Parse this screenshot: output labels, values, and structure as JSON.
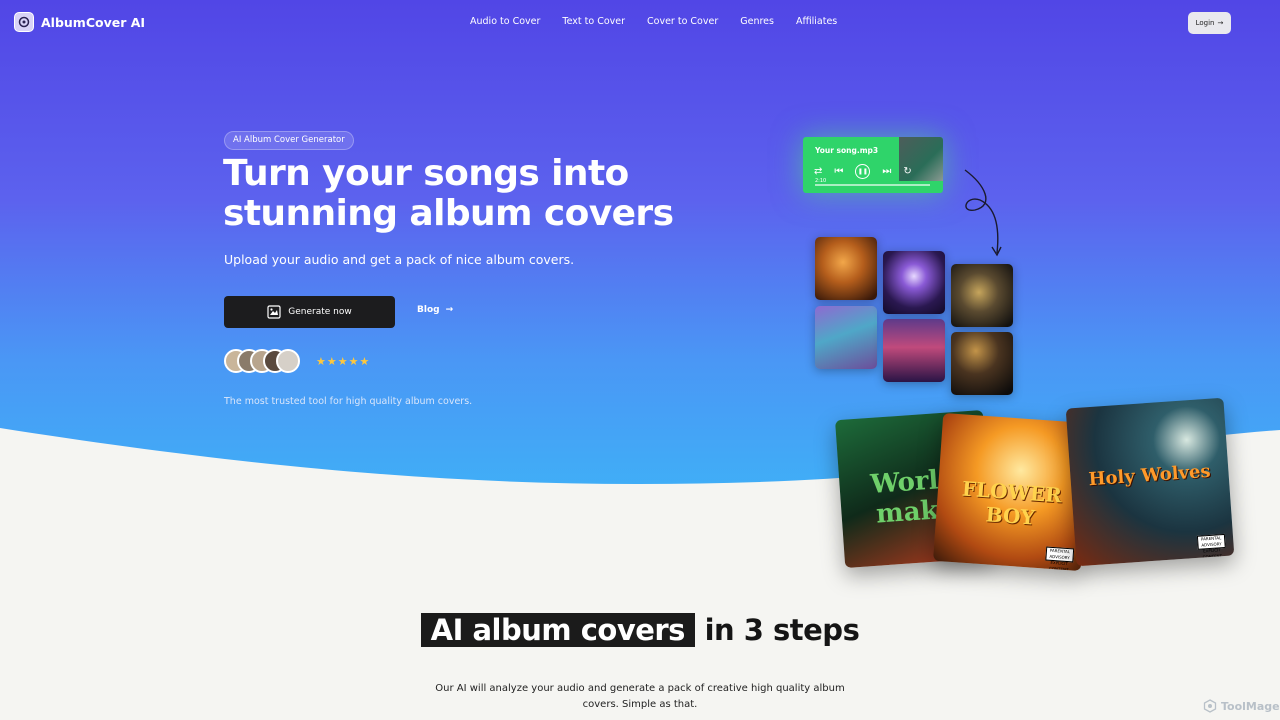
{
  "brand": {
    "name": "AlbumCover AI"
  },
  "nav": {
    "items": [
      "Audio to Cover",
      "Text to Cover",
      "Cover to Cover",
      "Genres",
      "Affiliates"
    ],
    "login_label": "Login"
  },
  "hero": {
    "badge": "AI Album Cover Generator",
    "title_line1": "Turn your songs into",
    "title_line2": "stunning album covers",
    "subtitle": "Upload your audio and get a pack of nice album covers.",
    "generate_label": "Generate now",
    "blog_label": "Blog",
    "stars": "★★★★★",
    "trusted": "The most trusted tool for high quality album covers."
  },
  "player": {
    "title": "Your song.mp3",
    "time": "2:10"
  },
  "covers": {
    "c1": "World\nmake",
    "c2": "FLOWER BOY",
    "c3": "Holy Wolves",
    "parental": "PARENTAL ADVISORY EXPLICIT CONTENT"
  },
  "steps": {
    "title_highlight": "AI album covers",
    "title_rest": "in 3 steps",
    "description": "Our AI will analyze your audio and generate a pack of creative high quality album covers. Simple as that."
  },
  "watermark": "ToolMage",
  "colors": {
    "hero_top": "#5146e6",
    "hero_bottom": "#3fb0f7",
    "button_dark": "#1c1c1e",
    "player_green": "#2fd46a",
    "star": "#ffc83d"
  }
}
